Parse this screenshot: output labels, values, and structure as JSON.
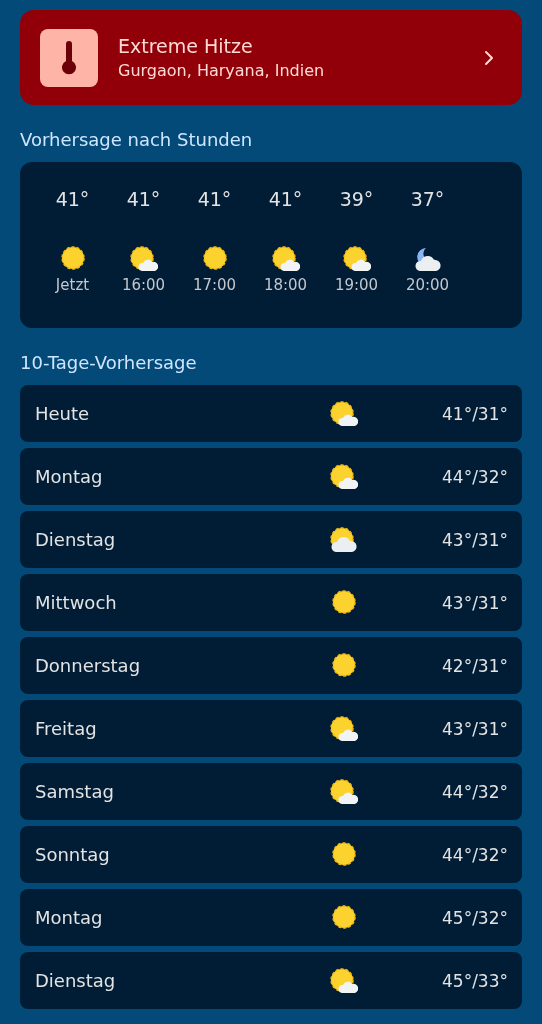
{
  "alert": {
    "title": "Extreme Hitze",
    "location": "Gurgaon, Haryana, Indien"
  },
  "hourly": {
    "heading": "Vorhersage nach Stunden",
    "items": [
      {
        "temp": "41°",
        "kind": "sun",
        "time": "Jetzt"
      },
      {
        "temp": "41°",
        "kind": "sun-cloud",
        "time": "16:00"
      },
      {
        "temp": "41°",
        "kind": "sun",
        "time": "17:00"
      },
      {
        "temp": "41°",
        "kind": "sun-cloud",
        "time": "18:00"
      },
      {
        "temp": "39°",
        "kind": "sun-cloud",
        "time": "19:00"
      },
      {
        "temp": "37°",
        "kind": "moon-cloud",
        "time": "20:00"
      }
    ]
  },
  "daily": {
    "heading": "10-Tage-Vorhersage",
    "days": [
      {
        "day": "Heute",
        "kind": "sun-cloud",
        "temps": "41°/31°"
      },
      {
        "day": "Montag",
        "kind": "sun-cloud",
        "temps": "44°/32°"
      },
      {
        "day": "Dienstag",
        "kind": "cloudy",
        "temps": "43°/31°"
      },
      {
        "day": "Mittwoch",
        "kind": "sun",
        "temps": "43°/31°"
      },
      {
        "day": "Donnerstag",
        "kind": "sun",
        "temps": "42°/31°"
      },
      {
        "day": "Freitag",
        "kind": "sun-cloud",
        "temps": "43°/31°"
      },
      {
        "day": "Samstag",
        "kind": "sun-cloud",
        "temps": "44°/32°"
      },
      {
        "day": "Sonntag",
        "kind": "sun",
        "temps": "44°/32°"
      },
      {
        "day": "Montag",
        "kind": "sun",
        "temps": "45°/32°"
      },
      {
        "day": "Dienstag",
        "kind": "sun-cloud",
        "temps": "45°/33°"
      }
    ]
  }
}
